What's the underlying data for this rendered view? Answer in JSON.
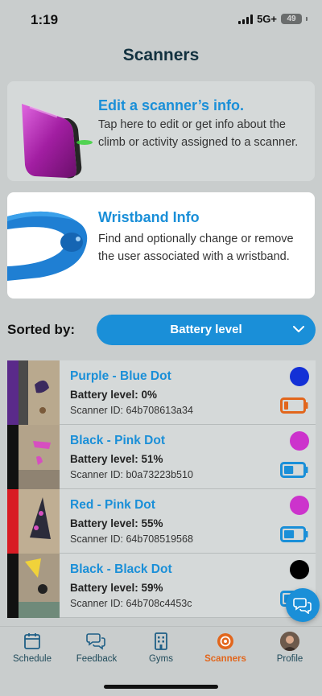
{
  "status": {
    "time": "1:19",
    "network": "5G+",
    "battery": "49"
  },
  "page": {
    "title": "Scanners"
  },
  "cards": {
    "edit": {
      "title": "Edit a scanner’s info.",
      "description": "Tap here to edit or get info about the climb or activity assigned to a scanner."
    },
    "wristband": {
      "title": "Wristband Info",
      "description": "Find and optionally change or remove the user associated with a wristband."
    }
  },
  "sort": {
    "label": "Sorted by:",
    "selected": "Battery level"
  },
  "scanners": [
    {
      "name": "Purple - Blue Dot",
      "battery": "Battery level: 0%",
      "battery_level": 0,
      "scanner_id": "Scanner ID: 64b708613a34",
      "stripe_color": "#5a2a8a",
      "dot_color": "#1330d6",
      "battery_color": "#e2661c"
    },
    {
      "name": "Black - Pink Dot",
      "battery": "Battery level: 51%",
      "battery_level": 0.51,
      "scanner_id": "Scanner ID: b0a73223b510",
      "stripe_color": "#111111",
      "dot_color": "#cc33cc",
      "battery_color": "#1a8fd8"
    },
    {
      "name": "Red - Pink Dot",
      "battery": "Battery level: 55%",
      "battery_level": 0.55,
      "scanner_id": "Scanner ID: 64b708519568",
      "stripe_color": "#d81c24",
      "dot_color": "#cc33cc",
      "battery_color": "#1a8fd8"
    },
    {
      "name": "Black - Black Dot",
      "battery": "Battery level: 59%",
      "battery_level": 0.59,
      "scanner_id": "Scanner ID: 64b708c4453c",
      "stripe_color": "#111111",
      "dot_color": "#000000",
      "battery_color": "#1a8fd8"
    }
  ],
  "tabs": [
    {
      "label": "Schedule",
      "icon": "calendar-icon",
      "active": false
    },
    {
      "label": "Feedback",
      "icon": "chat-bubbles-icon",
      "active": false
    },
    {
      "label": "Gyms",
      "icon": "building-icon",
      "active": false
    },
    {
      "label": "Scanners",
      "icon": "scanner-icon",
      "active": true
    },
    {
      "label": "Profile",
      "icon": "avatar-icon",
      "active": false
    }
  ],
  "colors": {
    "accent": "#1a8fd8",
    "active_tab": "#e2661c",
    "background": "#c9cdcd"
  }
}
